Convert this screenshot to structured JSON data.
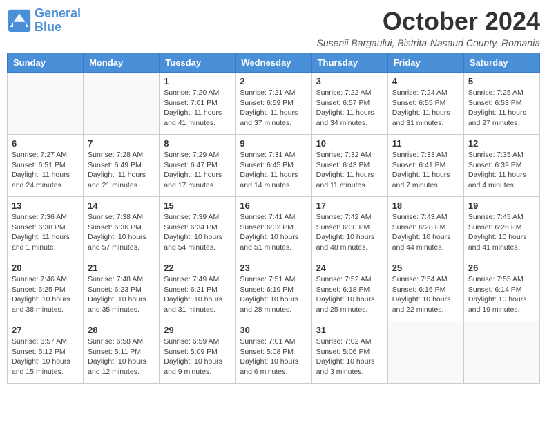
{
  "header": {
    "logo_line1": "General",
    "logo_line2": "Blue",
    "title": "October 2024",
    "subtitle": "Susenii Bargaului, Bistrita-Nasaud County, Romania"
  },
  "days_of_week": [
    "Sunday",
    "Monday",
    "Tuesday",
    "Wednesday",
    "Thursday",
    "Friday",
    "Saturday"
  ],
  "weeks": [
    [
      {
        "day": "",
        "info": ""
      },
      {
        "day": "",
        "info": ""
      },
      {
        "day": "1",
        "info": "Sunrise: 7:20 AM\nSunset: 7:01 PM\nDaylight: 11 hours and 41 minutes."
      },
      {
        "day": "2",
        "info": "Sunrise: 7:21 AM\nSunset: 6:59 PM\nDaylight: 11 hours and 37 minutes."
      },
      {
        "day": "3",
        "info": "Sunrise: 7:22 AM\nSunset: 6:57 PM\nDaylight: 11 hours and 34 minutes."
      },
      {
        "day": "4",
        "info": "Sunrise: 7:24 AM\nSunset: 6:55 PM\nDaylight: 11 hours and 31 minutes."
      },
      {
        "day": "5",
        "info": "Sunrise: 7:25 AM\nSunset: 6:53 PM\nDaylight: 11 hours and 27 minutes."
      }
    ],
    [
      {
        "day": "6",
        "info": "Sunrise: 7:27 AM\nSunset: 6:51 PM\nDaylight: 11 hours and 24 minutes."
      },
      {
        "day": "7",
        "info": "Sunrise: 7:28 AM\nSunset: 6:49 PM\nDaylight: 11 hours and 21 minutes."
      },
      {
        "day": "8",
        "info": "Sunrise: 7:29 AM\nSunset: 6:47 PM\nDaylight: 11 hours and 17 minutes."
      },
      {
        "day": "9",
        "info": "Sunrise: 7:31 AM\nSunset: 6:45 PM\nDaylight: 11 hours and 14 minutes."
      },
      {
        "day": "10",
        "info": "Sunrise: 7:32 AM\nSunset: 6:43 PM\nDaylight: 11 hours and 11 minutes."
      },
      {
        "day": "11",
        "info": "Sunrise: 7:33 AM\nSunset: 6:41 PM\nDaylight: 11 hours and 7 minutes."
      },
      {
        "day": "12",
        "info": "Sunrise: 7:35 AM\nSunset: 6:39 PM\nDaylight: 11 hours and 4 minutes."
      }
    ],
    [
      {
        "day": "13",
        "info": "Sunrise: 7:36 AM\nSunset: 6:38 PM\nDaylight: 11 hours and 1 minute."
      },
      {
        "day": "14",
        "info": "Sunrise: 7:38 AM\nSunset: 6:36 PM\nDaylight: 10 hours and 57 minutes."
      },
      {
        "day": "15",
        "info": "Sunrise: 7:39 AM\nSunset: 6:34 PM\nDaylight: 10 hours and 54 minutes."
      },
      {
        "day": "16",
        "info": "Sunrise: 7:41 AM\nSunset: 6:32 PM\nDaylight: 10 hours and 51 minutes."
      },
      {
        "day": "17",
        "info": "Sunrise: 7:42 AM\nSunset: 6:30 PM\nDaylight: 10 hours and 48 minutes."
      },
      {
        "day": "18",
        "info": "Sunrise: 7:43 AM\nSunset: 6:28 PM\nDaylight: 10 hours and 44 minutes."
      },
      {
        "day": "19",
        "info": "Sunrise: 7:45 AM\nSunset: 6:26 PM\nDaylight: 10 hours and 41 minutes."
      }
    ],
    [
      {
        "day": "20",
        "info": "Sunrise: 7:46 AM\nSunset: 6:25 PM\nDaylight: 10 hours and 38 minutes."
      },
      {
        "day": "21",
        "info": "Sunrise: 7:48 AM\nSunset: 6:23 PM\nDaylight: 10 hours and 35 minutes."
      },
      {
        "day": "22",
        "info": "Sunrise: 7:49 AM\nSunset: 6:21 PM\nDaylight: 10 hours and 31 minutes."
      },
      {
        "day": "23",
        "info": "Sunrise: 7:51 AM\nSunset: 6:19 PM\nDaylight: 10 hours and 28 minutes."
      },
      {
        "day": "24",
        "info": "Sunrise: 7:52 AM\nSunset: 6:18 PM\nDaylight: 10 hours and 25 minutes."
      },
      {
        "day": "25",
        "info": "Sunrise: 7:54 AM\nSunset: 6:16 PM\nDaylight: 10 hours and 22 minutes."
      },
      {
        "day": "26",
        "info": "Sunrise: 7:55 AM\nSunset: 6:14 PM\nDaylight: 10 hours and 19 minutes."
      }
    ],
    [
      {
        "day": "27",
        "info": "Sunrise: 6:57 AM\nSunset: 5:12 PM\nDaylight: 10 hours and 15 minutes."
      },
      {
        "day": "28",
        "info": "Sunrise: 6:58 AM\nSunset: 5:11 PM\nDaylight: 10 hours and 12 minutes."
      },
      {
        "day": "29",
        "info": "Sunrise: 6:59 AM\nSunset: 5:09 PM\nDaylight: 10 hours and 9 minutes."
      },
      {
        "day": "30",
        "info": "Sunrise: 7:01 AM\nSunset: 5:08 PM\nDaylight: 10 hours and 6 minutes."
      },
      {
        "day": "31",
        "info": "Sunrise: 7:02 AM\nSunset: 5:06 PM\nDaylight: 10 hours and 3 minutes."
      },
      {
        "day": "",
        "info": ""
      },
      {
        "day": "",
        "info": ""
      }
    ]
  ]
}
